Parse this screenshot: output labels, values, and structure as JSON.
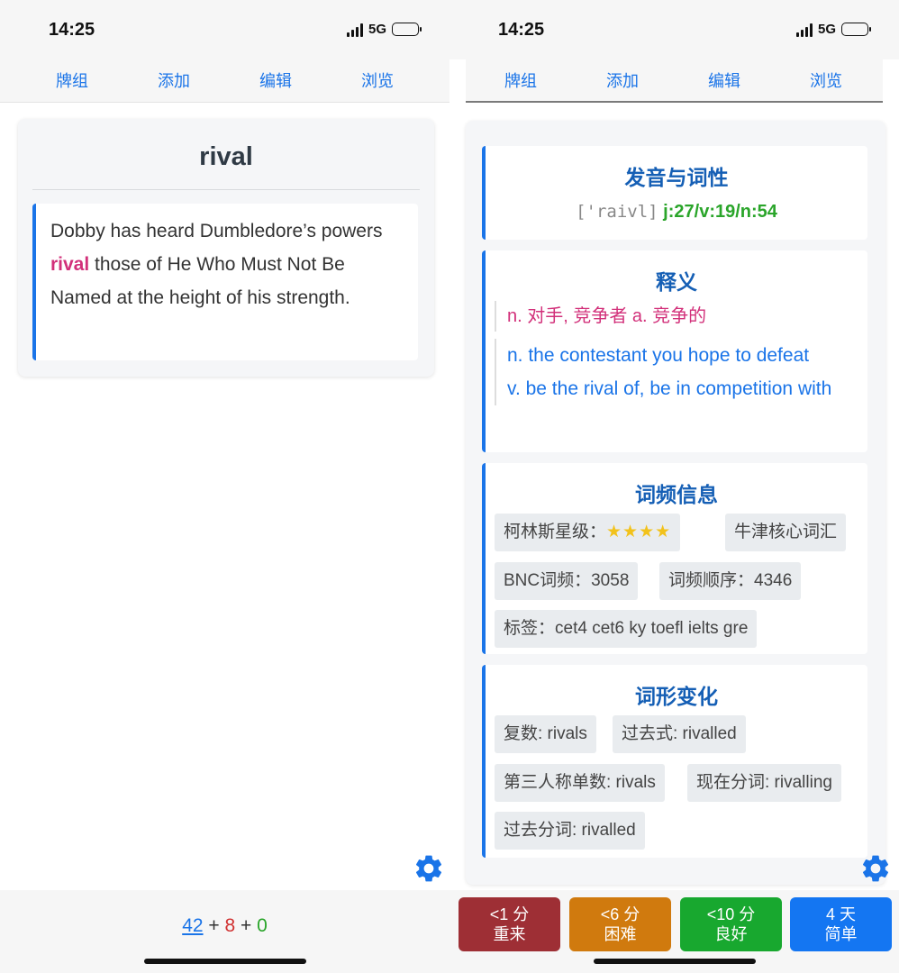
{
  "status": {
    "time": "14:25",
    "network": "5G"
  },
  "tabs": [
    "牌组",
    "添加",
    "编辑",
    "浏览"
  ],
  "front": {
    "word": "rival",
    "sentence_before": "Dobby has heard Dumbledore’s powers ",
    "sentence_highlight": "rival",
    "sentence_after": " those of He Who Must Not Be Named at the height of his strength."
  },
  "counts": {
    "new": "42",
    "learning": "8",
    "review": "0",
    "sep1": " + ",
    "sep2": " + "
  },
  "back": {
    "pronunciation": {
      "title": "发音与词性",
      "phonetic": "['raivl]",
      "codes": "j:27/v:19/n:54"
    },
    "meaning": {
      "title": "释义",
      "zh": "n. 对手, 竞争者 a. 竞争的",
      "en_line1": "n. the contestant you hope to defeat",
      "en_line2": "v. be the rival of, be in competition with"
    },
    "frequency": {
      "title": "词频信息",
      "collins_label": "柯林斯星级：",
      "collins_stars": 4,
      "collins_stars_text": "★★★★",
      "oxford": "牛津核心词汇",
      "bnc": "BNC词频：3058",
      "order": "词频顺序：4346",
      "tags": "标签：cet4 cet6 ky toefl ielts gre"
    },
    "forms": {
      "title": "词形变化",
      "plural": "复数: rivals",
      "past": "过去式: rivalled",
      "third": "第三人称单数: rivals",
      "present_participle": "现在分词: rivalling",
      "past_participle": "过去分词: rivalled"
    }
  },
  "answer_buttons": [
    {
      "interval": "<1 分",
      "label": "重来",
      "color": "#9e2f35"
    },
    {
      "interval": "<6 分",
      "label": "困难",
      "color": "#d07a0e"
    },
    {
      "interval": "<10 分",
      "label": "良好",
      "color": "#18a82f"
    },
    {
      "interval": "4 天",
      "label": "简单",
      "color": "#1476f2"
    }
  ],
  "colors": {
    "accent": "#1a74e8",
    "highlight": "#d2307a",
    "title": "#155fb5",
    "freq_code": "#2aa52a"
  }
}
